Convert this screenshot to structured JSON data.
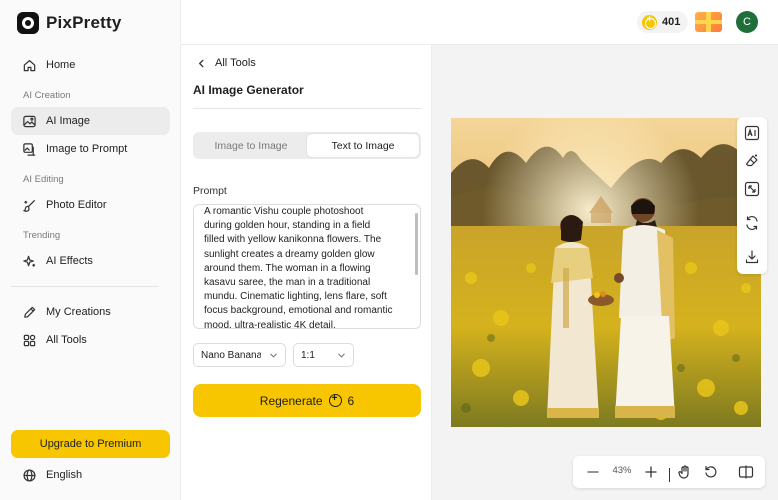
{
  "app": {
    "name": "PixPretty"
  },
  "sidebar": {
    "home": "Home",
    "section_creation": "AI Creation",
    "ai_image": "AI Image",
    "image_to_prompt": "Image to Prompt",
    "section_editing": "AI Editing",
    "photo_editor": "Photo Editor",
    "section_trending": "Trending",
    "ai_effects": "AI Effects",
    "my_creations": "My Creations",
    "all_tools": "All Tools",
    "upgrade": "Upgrade to Premium",
    "language": "English"
  },
  "topbar": {
    "credits": "401",
    "avatar_initial": "C"
  },
  "panel": {
    "back_label": "All Tools",
    "title": "AI Image Generator",
    "tabs": [
      {
        "label": "Image to Image",
        "active": false
      },
      {
        "label": "Text to Image",
        "active": true
      }
    ],
    "prompt_label": "Prompt",
    "prompt_lines": [
      "A romantic Vishu couple photoshoot",
      "during golden hour, standing in a field",
      "filled with yellow kanikonna flowers. The",
      "sunlight creates a dreamy golden glow",
      "around them. The woman in a flowing",
      "kasavu saree, the man in a traditional",
      "mundu. Cinematic lighting, lens flare, soft",
      "focus background, emotional and romantic",
      "mood, ultra-realistic 4K detail."
    ],
    "model_value": "Nano Banana",
    "ratio_value": "1:1",
    "regenerate_label": "Regenerate",
    "regenerate_cost": "6"
  },
  "canvas": {
    "zoom": "43%",
    "image_subject": "couple in kasavu saree and mundu standing in a yellow flower field at golden hour"
  },
  "colors": {
    "accent": "#f7c600",
    "avatar": "#1f6f3a",
    "active_nav": "#ececec",
    "canvas_bg": "#f3f3f3"
  },
  "icons": {
    "home": "home-icon",
    "ai_image": "image-icon",
    "image_to_prompt": "image-text-icon",
    "photo_editor": "brush-icon",
    "ai_effects": "sparkle-icon",
    "my_creations": "pen-icon",
    "all_tools": "grid-icon",
    "language": "globe-icon",
    "side_tools": [
      "ai-icon",
      "eraser-icon",
      "expand-icon",
      "replace-icon",
      "download-icon"
    ],
    "bottom_tools": [
      "zoom-out-icon",
      "zoom-in-icon",
      "hand-icon",
      "reset-icon",
      "compare-icon"
    ]
  }
}
